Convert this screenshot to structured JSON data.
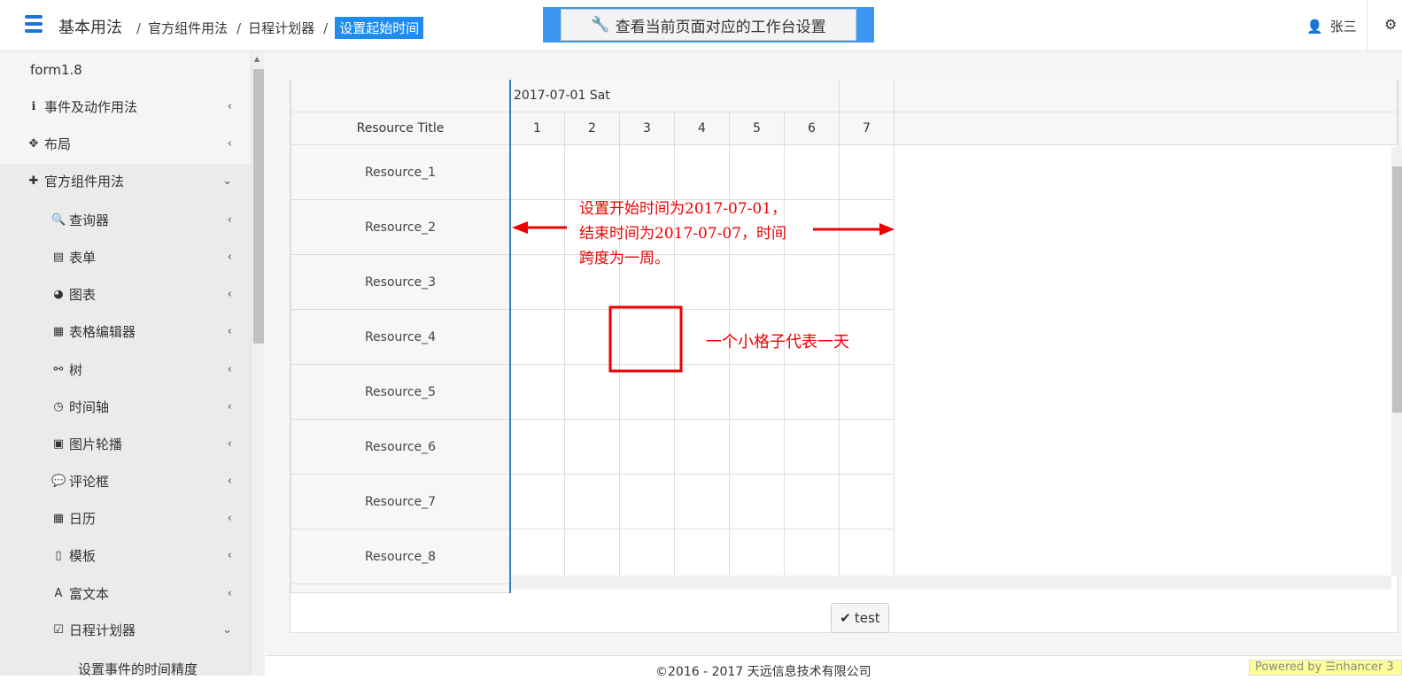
{
  "header": {
    "brand": "基本用法",
    "breadcrumbs": [
      "官方组件用法",
      "日程计划器"
    ],
    "breadcrumb_current": "设置起始时间",
    "workbench_button": "查看当前页面对应的工作台设置",
    "user_name": "张三",
    "accent_color": "#1e8cf0"
  },
  "sidebar": {
    "items": [
      {
        "label": "form1.8",
        "icon": "",
        "level": 0
      },
      {
        "label": "事件及动作用法",
        "icon": "info-icon",
        "level": 0,
        "arrow": "‹"
      },
      {
        "label": "布局",
        "icon": "move-icon",
        "level": 0,
        "arrow": "‹"
      },
      {
        "label": "官方组件用法",
        "icon": "puzzle-icon",
        "level": 0,
        "arrow": "⌄"
      },
      {
        "label": "查询器",
        "icon": "search-icon",
        "level": 1,
        "arrow": "‹"
      },
      {
        "label": "表单",
        "icon": "form-icon",
        "level": 1,
        "arrow": "‹"
      },
      {
        "label": "图表",
        "icon": "pie-chart-icon",
        "level": 1,
        "arrow": "‹"
      },
      {
        "label": "表格编辑器",
        "icon": "table-icon",
        "level": 1,
        "arrow": "‹"
      },
      {
        "label": "树",
        "icon": "sitemap-icon",
        "level": 1,
        "arrow": "‹"
      },
      {
        "label": "时间轴",
        "icon": "clock-icon",
        "level": 1,
        "arrow": "‹"
      },
      {
        "label": "图片轮播",
        "icon": "image-icon",
        "level": 1,
        "arrow": "‹"
      },
      {
        "label": "评论框",
        "icon": "comment-icon",
        "level": 1,
        "arrow": "‹"
      },
      {
        "label": "日历",
        "icon": "calendar-icon",
        "level": 1,
        "arrow": "‹"
      },
      {
        "label": "模板",
        "icon": "file-code-icon",
        "level": 1,
        "arrow": "‹"
      },
      {
        "label": "富文本",
        "icon": "font-icon",
        "level": 1,
        "arrow": "‹"
      },
      {
        "label": "日程计划器",
        "icon": "calendar-check-icon",
        "level": 1,
        "arrow": "⌄"
      },
      {
        "label": "设置事件的时间精度",
        "icon": "",
        "level": 2
      }
    ]
  },
  "scheduler": {
    "date_header": "2017-07-01 Sat",
    "resource_title": "Resource Title",
    "days": [
      "1",
      "2",
      "3",
      "4",
      "5",
      "6",
      "7"
    ],
    "resources": [
      "Resource_1",
      "Resource_2",
      "Resource_3",
      "Resource_4",
      "Resource_5",
      "Resource_6",
      "Resource_7",
      "Resource_8"
    ]
  },
  "annotations": {
    "range_text": [
      "设置开始时间为2017-07-01，",
      "结束时间为2017-07-07，时间",
      "跨度为一周。"
    ],
    "cell_text": "一个小格子代表一天",
    "color": "#e00000"
  },
  "test_button": "test",
  "footer": {
    "copyright": "©2016 - 2017 天远信息技术有限公司",
    "powered": "Powered by ☰nhancer 3"
  }
}
